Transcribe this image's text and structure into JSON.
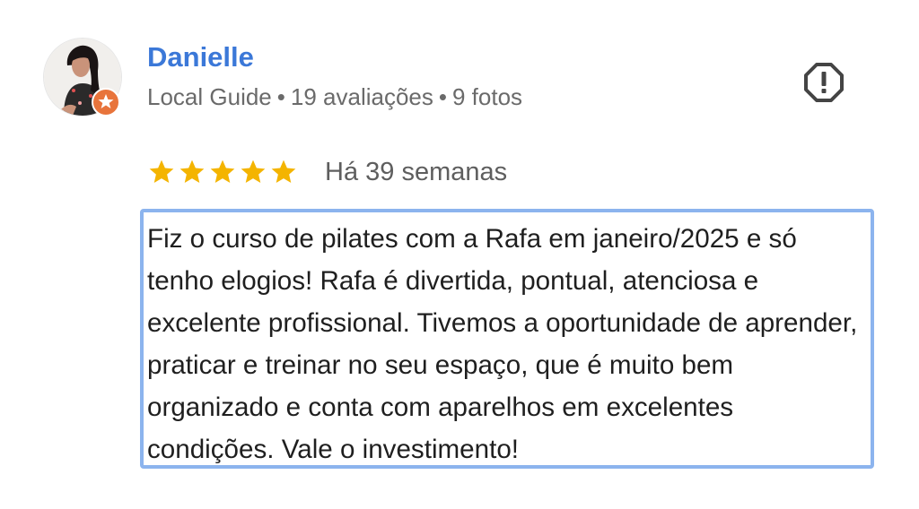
{
  "review": {
    "author": {
      "name": "Danielle",
      "badge": "Local Guide",
      "reviews_count": "19 avaliações",
      "photos_count": "9 fotos",
      "separator": "•",
      "avatar_icon": "profile-photo",
      "guide_badge_icon": "star-badge-icon"
    },
    "report_icon": "report-exclamation-icon",
    "rating": {
      "stars": 5,
      "max": 5,
      "star_color": "#f4b400"
    },
    "date": "Há 39 semanas",
    "text": "Fiz o curso de pilates com a Rafa em janeiro/2025 e só tenho elogios! Rafa é divertida, pontual, atenciosa e excelente profissional. Tivemos a oportunidade de aprender, praticar e treinar no seu espaço, que é muito bem organizado e conta com aparelhos em excelentes condições. Vale o investimento!",
    "colors": {
      "name": "#3b78d8",
      "meta": "#6a6a6a",
      "highlight_border": "#8cb4ee",
      "badge": "#e8743b"
    }
  }
}
